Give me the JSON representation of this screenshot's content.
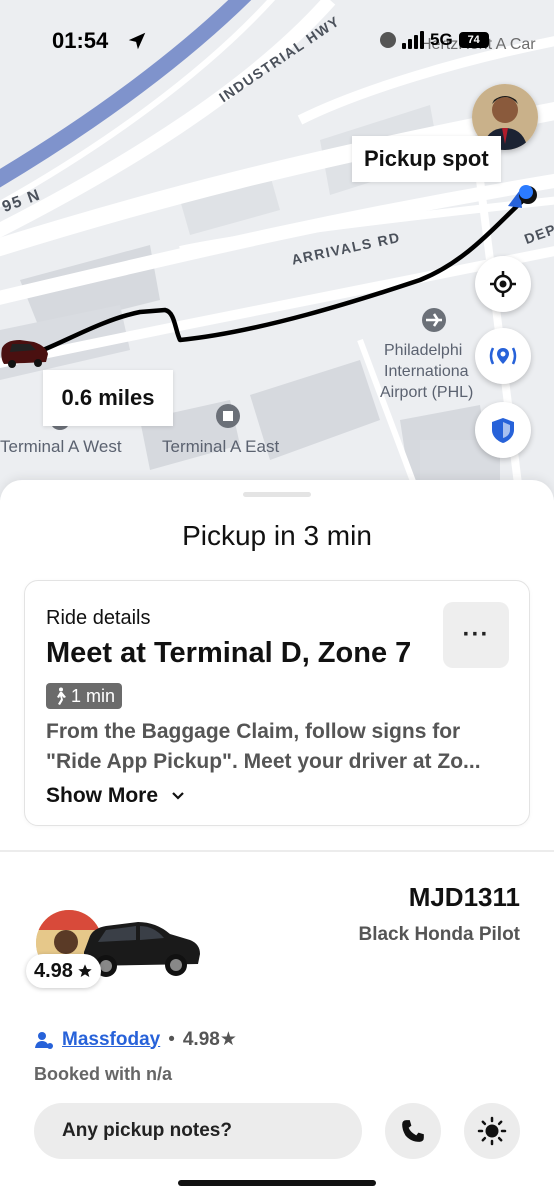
{
  "status_bar": {
    "time": "01:54",
    "network": "5G",
    "battery": "74"
  },
  "map": {
    "overlay_text": "HertzRent A Car",
    "roads": {
      "industrial_hwy": "INDUSTRIAL HWY",
      "i95": "95 N",
      "arrivals_rd": "ARRIVALS RD",
      "departures": "DEP"
    },
    "places": {
      "airport_line1": "Philadelphi",
      "airport_line2": "Internationa",
      "airport_line3": "Airport (PHL)",
      "terminal_a_west": "Terminal A West",
      "terminal_a_east": "Terminal A East"
    },
    "pickup_spot_label": "Pickup spot",
    "distance_label": "0.6 miles",
    "route_color": "#000000",
    "accent": "#2762d9"
  },
  "sheet": {
    "pickup_title": "Pickup in 3 min",
    "ride_card": {
      "label": "Ride details",
      "heading": "Meet at Terminal D, Zone 7",
      "walk_time": "1 min",
      "desc_line1": "From the Baggage Claim, follow signs for",
      "desc_line2": "\"Ride App Pickup\". Meet your driver at Zo...",
      "show_more": "Show More",
      "more_button": "···"
    },
    "vehicle": {
      "plate": "MJD1311",
      "model": "Black Honda Pilot",
      "rating": "4.98"
    },
    "driver": {
      "name": "Massfoday",
      "separator": "•",
      "rating": "4.98★",
      "booked_with": "Booked with n/a"
    },
    "notes_placeholder": "Any pickup notes?"
  }
}
